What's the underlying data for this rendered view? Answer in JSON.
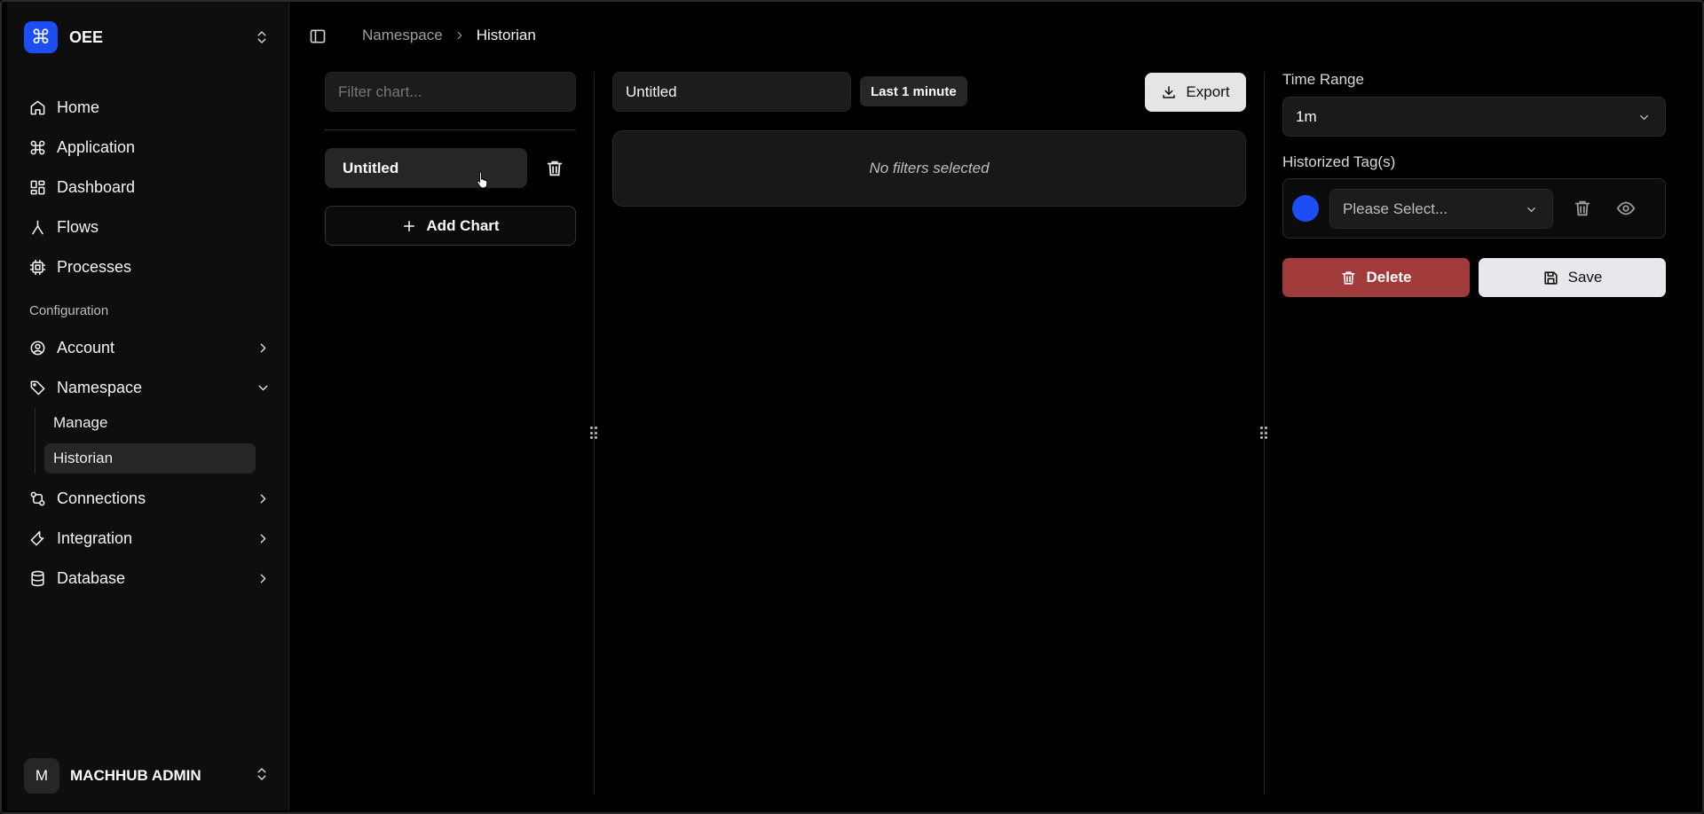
{
  "brand": {
    "name": "OEE",
    "logo_glyph": "⌘",
    "accent": "#1d4ef5"
  },
  "nav": {
    "items": [
      {
        "label": "Home",
        "icon": "home-icon"
      },
      {
        "label": "Application",
        "icon": "command-icon"
      },
      {
        "label": "Dashboard",
        "icon": "dashboard-icon"
      },
      {
        "label": "Flows",
        "icon": "flows-icon"
      },
      {
        "label": "Processes",
        "icon": "cpu-icon"
      }
    ],
    "section_label": "Configuration",
    "config_items": [
      {
        "label": "Account",
        "icon": "user-circle-icon"
      },
      {
        "label": "Namespace",
        "icon": "tag-icon"
      },
      {
        "label": "Connections",
        "icon": "connections-icon"
      },
      {
        "label": "Integration",
        "icon": "wrench-icon"
      },
      {
        "label": "Database",
        "icon": "database-icon"
      }
    ],
    "namespace_sub": [
      {
        "label": "Manage"
      },
      {
        "label": "Historian"
      }
    ]
  },
  "user": {
    "initial": "M",
    "name": "MACHHUB ADMIN"
  },
  "breadcrumb": {
    "parent": "Namespace",
    "current": "Historian"
  },
  "charts": {
    "filter_placeholder": "Filter chart...",
    "items": [
      {
        "label": "Untitled"
      }
    ],
    "add_label": "Add Chart"
  },
  "editor": {
    "title": "Untitled",
    "range_badge": "Last 1 minute",
    "export_label": "Export",
    "empty_filters": "No filters selected"
  },
  "settings": {
    "time_range_label": "Time Range",
    "time_range_value": "1m",
    "tags_label": "Historized Tag(s)",
    "tag_placeholder": "Please Select...",
    "tag_color": "#1d4ef5",
    "delete_label": "Delete",
    "save_label": "Save",
    "delete_color": "#a13a3a"
  }
}
